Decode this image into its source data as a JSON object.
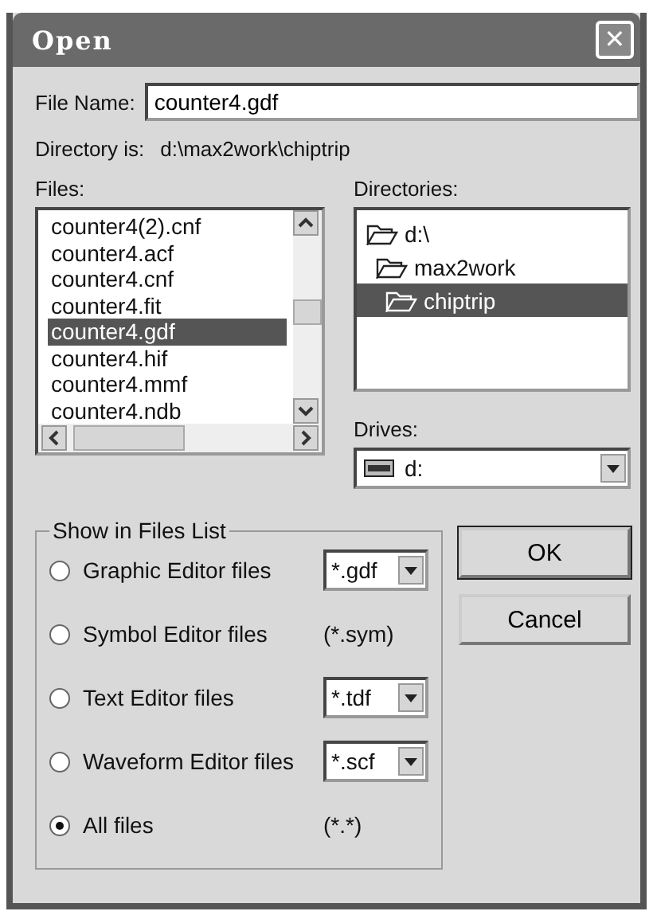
{
  "window": {
    "title": "Open",
    "close": "✕"
  },
  "file_name": {
    "label": "File Name:",
    "value": "counter4.gdf"
  },
  "directory": {
    "label": "Directory is:",
    "path": "d:\\max2work\\chiptrip"
  },
  "files": {
    "label": "Files:",
    "items": [
      {
        "name": "counter4(2).cnf",
        "selected": false
      },
      {
        "name": "counter4.acf",
        "selected": false
      },
      {
        "name": "counter4.cnf",
        "selected": false
      },
      {
        "name": "counter4.fit",
        "selected": false
      },
      {
        "name": "counter4.gdf",
        "selected": true
      },
      {
        "name": "counter4.hif",
        "selected": false
      },
      {
        "name": "counter4.mmf",
        "selected": false
      },
      {
        "name": "counter4.ndb",
        "selected": false
      }
    ]
  },
  "directories": {
    "label": "Directories:",
    "items": [
      {
        "name": "d:\\",
        "selected": false,
        "children": [
          {
            "name": "max2work",
            "selected": false,
            "children": [
              {
                "name": "chiptrip",
                "selected": true
              }
            ]
          }
        ]
      }
    ]
  },
  "drives": {
    "label": "Drives:",
    "value": "d:"
  },
  "show_in_files_list": {
    "title": "Show in Files List",
    "options": [
      {
        "label": "Graphic Editor files",
        "selected": false,
        "kind": "dropdown",
        "filter": "*.gdf"
      },
      {
        "label": "Symbol Editor files",
        "selected": false,
        "kind": "static",
        "filter": "(*.sym)"
      },
      {
        "label": "Text Editor files",
        "selected": false,
        "kind": "dropdown",
        "filter": "*.tdf"
      },
      {
        "label": "Waveform Editor files",
        "selected": false,
        "kind": "dropdown",
        "filter": "*.scf"
      },
      {
        "label": "All files",
        "selected": true,
        "kind": "static",
        "filter": "(*.*)"
      }
    ]
  },
  "buttons": [
    {
      "label": "OK",
      "default": true
    },
    {
      "label": "Cancel",
      "default": false
    }
  ]
}
